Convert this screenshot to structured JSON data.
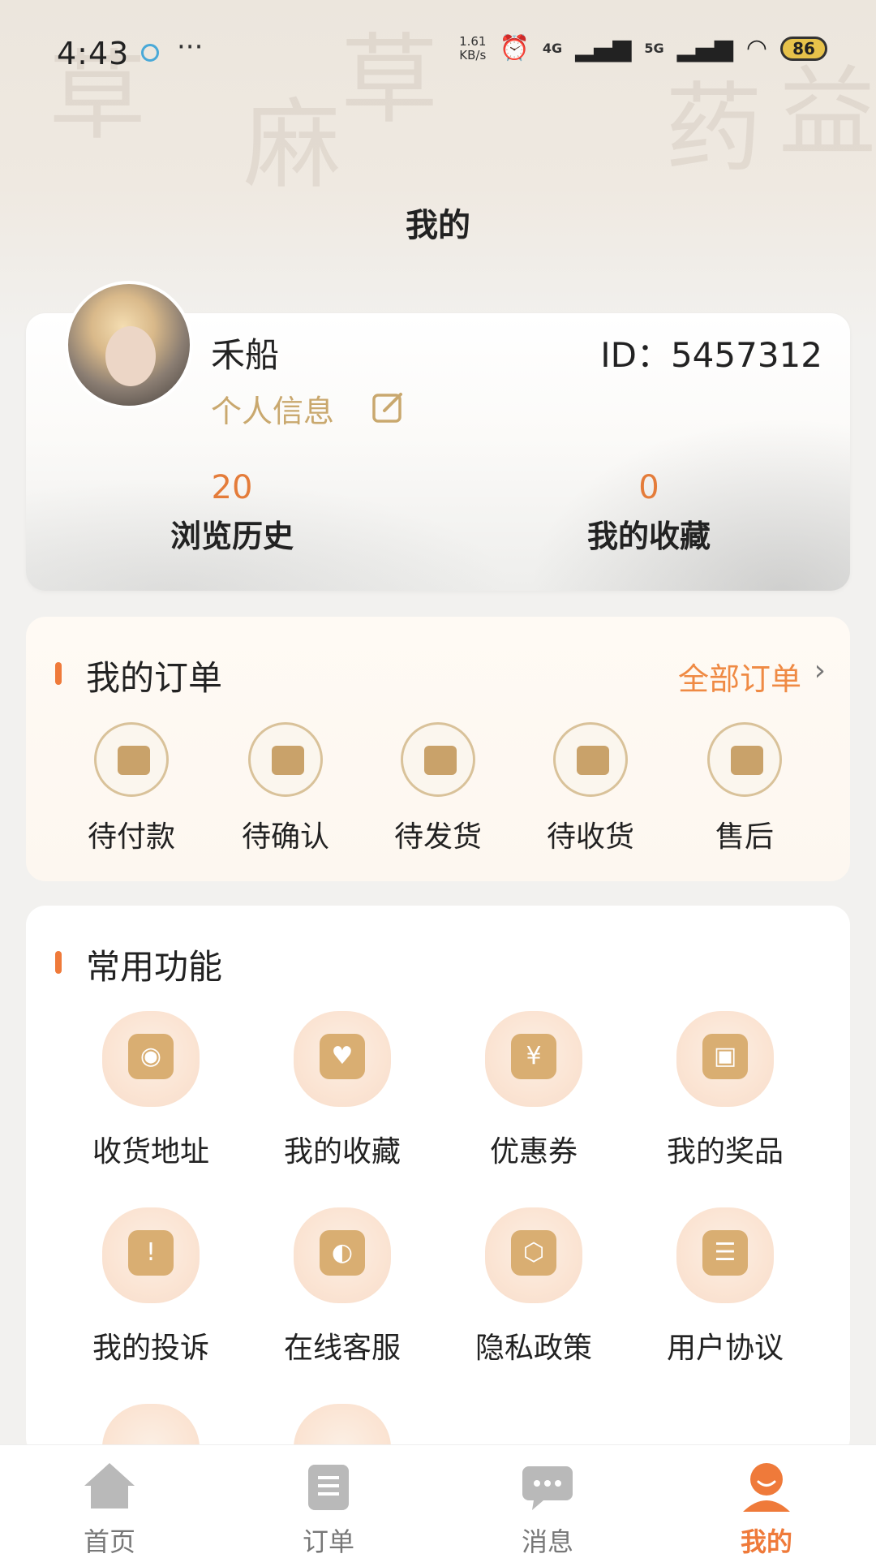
{
  "status_bar": {
    "time": "4:43",
    "more": "···",
    "net_speed_value": "1.61",
    "net_speed_unit": "KB/s",
    "signal_4g": "4G",
    "signal_5g": "5G",
    "battery": "86"
  },
  "header": {
    "title": "我的"
  },
  "profile": {
    "name": "禾船",
    "id_text": "ID：5457312",
    "info_link": "个人信息",
    "stats": [
      {
        "value": "20",
        "label": "浏览历史"
      },
      {
        "value": "0",
        "label": "我的收藏"
      }
    ]
  },
  "orders": {
    "title": "我的订单",
    "all_link": "全部订单",
    "items": [
      {
        "label": "待付款",
        "icon": "wallet-icon"
      },
      {
        "label": "待确认",
        "icon": "confirm-icon"
      },
      {
        "label": "待发货",
        "icon": "truck-icon"
      },
      {
        "label": "待收货",
        "icon": "receive-icon"
      },
      {
        "label": "售后",
        "icon": "return-icon"
      }
    ]
  },
  "functions": {
    "title": "常用功能",
    "items": [
      {
        "label": "收货地址",
        "icon": "location-icon"
      },
      {
        "label": "我的收藏",
        "icon": "heart-icon"
      },
      {
        "label": "优惠券",
        "icon": "coupon-icon"
      },
      {
        "label": "我的奖品",
        "icon": "gift-icon"
      },
      {
        "label": "我的投诉",
        "icon": "complaint-icon"
      },
      {
        "label": "在线客服",
        "icon": "headset-icon"
      },
      {
        "label": "隐私政策",
        "icon": "shield-icon"
      },
      {
        "label": "用户协议",
        "icon": "agreement-icon"
      }
    ]
  },
  "tabbar": {
    "items": [
      {
        "label": "首页",
        "icon": "home-icon"
      },
      {
        "label": "订单",
        "icon": "clipboard-icon"
      },
      {
        "label": "消息",
        "icon": "message-icon"
      },
      {
        "label": "我的",
        "icon": "user-icon"
      }
    ],
    "active_index": 3
  },
  "colors": {
    "accent": "#ef7a3a",
    "gold": "#c9a86e"
  }
}
